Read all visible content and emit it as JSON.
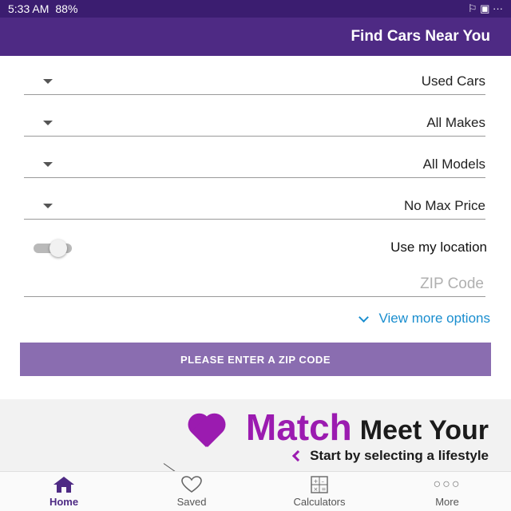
{
  "status_bar": {
    "time": "5:33 AM",
    "battery": "88%",
    "indicators": "⚐ ▣ ···"
  },
  "header": {
    "title": "Find Cars Near You"
  },
  "form": {
    "dropdowns": [
      {
        "label": "Used Cars"
      },
      {
        "label": "All Makes"
      },
      {
        "label": "All Models"
      },
      {
        "label": "No Max Price"
      }
    ],
    "use_location_label": "Use my location",
    "use_location_on": false,
    "zip_placeholder": "ZIP Code",
    "more_options_label": "View more options",
    "submit_label": "PLEASE ENTER A ZIP CODE"
  },
  "promo": {
    "meet_your": "Meet Your",
    "match": "Match",
    "subtitle": "Start by selecting a lifestyle",
    "accent_color": "#9b1bb0"
  },
  "bottom_nav": [
    {
      "label": "Home",
      "icon": "home-icon",
      "active": true
    },
    {
      "label": "Saved",
      "icon": "heart-outline-icon",
      "active": false
    },
    {
      "label": "Calculators",
      "icon": "calculator-icon",
      "active": false
    },
    {
      "label": "More",
      "icon": "more-dots-icon",
      "active": false
    }
  ],
  "colors": {
    "status_bar": "#3b1d70",
    "header": "#4e2a84",
    "button": "#8a6db0",
    "link": "#1a8ecf"
  }
}
